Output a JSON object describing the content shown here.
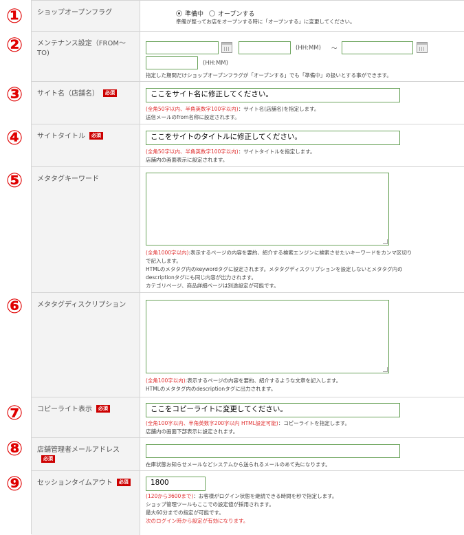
{
  "markers": [
    "①",
    "②",
    "③",
    "④",
    "⑤",
    "⑥",
    "⑦",
    "⑧",
    "⑨"
  ],
  "required_badge": "必須",
  "rows": {
    "shop_flag": {
      "label": "ショップオープンフラグ",
      "option_preparing": "準備中",
      "option_open": "オープンする",
      "selected": "準備中",
      "note": "準備が整ってお店をオープンする時に「オープンする」に変更してください。"
    },
    "maintenance": {
      "label": "メンテナンス設定（FROM〜TO)",
      "from_value": "",
      "to_value": "",
      "time_from_value": "",
      "time_to_value": "",
      "hhmm_label": "(HH:MM)",
      "tilde": "〜",
      "note": "指定した期間だけショップオープンフラグが「オープンする」でも「準備中」の扱いとする事ができます。"
    },
    "site_name": {
      "label": "サイト名（店舗名）",
      "value": "ここをサイト名に修正してください。",
      "note_red": "(全角50字以内、半角英数字100字以内)",
      "note_1": "：サイト名(店舗名)を指定します。",
      "note_2": "送信メールのfrom名称に設定されます。"
    },
    "site_title": {
      "label": "サイトタイトル",
      "value": "ここをサイトのタイトルに修正してください。",
      "note_red": "(全角50字以内、半角英数字100字以内)",
      "note_1": "：サイトタイトルを指定します。",
      "note_2": "店舗内の画面表示に設定されます。"
    },
    "meta_keyword": {
      "label": "メタタグキーワード",
      "value": "",
      "note_red": "(全角1000字以内)",
      "note_1": ":表示するページの内容を要約、紹介する検索エンジンに検索させたいキーワードをカンマ区切り",
      "note_2": "で記入します。",
      "note_3": "HTMLのメタタグ内のkeywordタグに設定されます。メタタグディスクリプションを設定しないとメタタグ内の",
      "note_4": "descriptionタグにも同じ内容が出力されます。",
      "note_5": "カテゴリページ、商品詳細ページは別途設定が可能です。"
    },
    "meta_description": {
      "label": "メタタグディスクリプション",
      "value": "",
      "note_red": "(全角100字以内)",
      "note_1": ":表示するページの内容を要約、紹介するような文章を記入します。",
      "note_2": "HTMLのメタタグ内のdescriptionタグに出力されます。"
    },
    "copyright": {
      "label": "コピーライト表示",
      "value": "ここをコピーライトに変更してください。",
      "note_red": "(全角100字以内、半角英数字200字以内 HTML設定可能)",
      "note_1": "：コピーライトを指定します。",
      "note_2": "店舗内の画面下部表示に設定されます。"
    },
    "admin_email": {
      "label": "店舗管理者メールアドレス",
      "value": "",
      "note_1": "在庫状態お知らせメールなどシステムから送られるメールのあて先になります。"
    },
    "session_timeout": {
      "label": "セッションタイムアウト",
      "value": "1800",
      "note_red": "(120から3600まで)",
      "note_1": "：お客様がログイン状態を継続できる時間を秒で指定します。",
      "note_2": "ショップ管理ツールもここでの設定値が採用されます。",
      "note_3": "最大60分までの指定が可能です。",
      "note_4": "次のログイン時から設定が有効になります。"
    }
  }
}
